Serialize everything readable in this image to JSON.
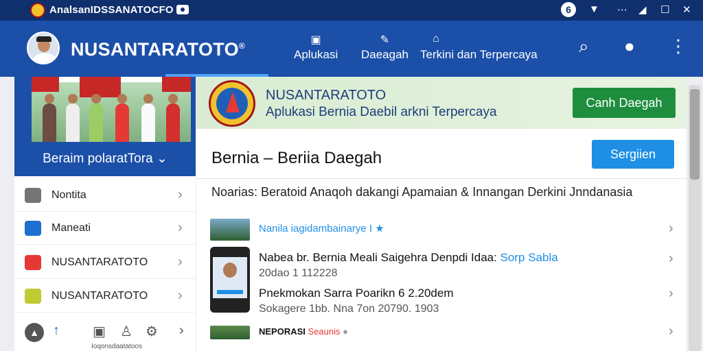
{
  "status_bar": {
    "title": "AnalsanIDSSANATOCFO",
    "badge": "6",
    "icons": [
      "record-icon",
      "wifi-icon",
      "dots-icon",
      "signal-icon",
      "maximize-icon",
      "close-icon"
    ]
  },
  "app_bar": {
    "brand": "NUSANTARATOTO",
    "registered": "®",
    "nav": [
      {
        "label": "Aplukasi",
        "icon": "app-icon"
      },
      {
        "label": "Daeagah",
        "icon": "pen-icon"
      },
      {
        "label": "Terkini dan  Terpercaya",
        "icon": "home-icon"
      }
    ],
    "actions": [
      "search-icon",
      "user-icon",
      "more-vert-icon"
    ]
  },
  "sidebar": {
    "hero_label": "Beraim polaratTora",
    "items": [
      {
        "label": "Nontita",
        "color": "#757575"
      },
      {
        "label": "Maneati",
        "color": "#1e6fd0"
      },
      {
        "label": "NUSANTARATOTO",
        "color": "#e53935"
      },
      {
        "label": "NUSANTARATOTO",
        "color": "#c0ca33"
      }
    ],
    "bottom_caption": "Ioqonsdaatatoos"
  },
  "main": {
    "banner": {
      "title": "NUSANTARATOTO",
      "subtitle": "Aplukasi Bernia Daebil arkni Terpercaya",
      "button": "Canh Daegah"
    },
    "section": {
      "title": "Bernia  –  Beriia Daegah",
      "button": "Sergiien"
    },
    "headline": "Noarias: Beratoid Anaqoh dakangi Apamaian & Innangan Derkini Jnndanasia",
    "news": [
      {
        "title": "Nanila iagidambainarye",
        "suffix": " I ★",
        "meta": ""
      },
      {
        "title": "Nabea br. Bernia Meali Saigehra Denpdi Idaa:",
        "link": " Sorp Sabla",
        "meta": "20dao 1 112228"
      },
      {
        "title": "Pnekmokan Sarra Poarikn 6 2.20dem",
        "meta": "Sokagere 1bb. Nna 7on 20790. 1903"
      },
      {
        "title": "NEPORASI",
        "tag": " Seaunis",
        "meta": ""
      }
    ]
  },
  "colors": {
    "status_bg": "#0f2f6d",
    "appbar_bg": "#1b4fa8",
    "accent_green": "#1e8e3e",
    "accent_blue": "#1f8fe5"
  }
}
